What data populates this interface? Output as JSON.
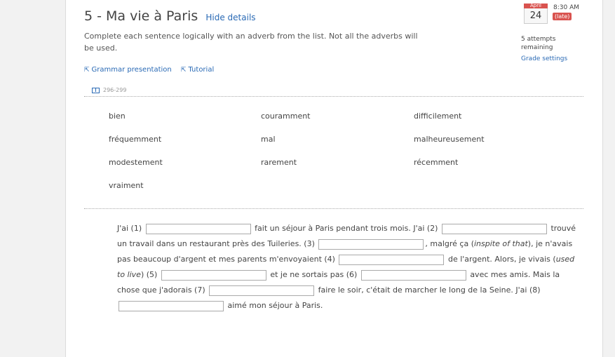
{
  "header": {
    "title": "5 - Ma vie à Paris",
    "hide_details": "Hide details"
  },
  "instructions": "Complete each sentence logically with an adverb from the list. Not all the adverbs will be used.",
  "links": {
    "grammar": "Grammar presentation",
    "tutorial": "Tutorial"
  },
  "book": {
    "pages": "296-299"
  },
  "word_bank": [
    "bien",
    "couramment",
    "difficilement",
    "fréquemment",
    "mal",
    "malheureusement",
    "modestement",
    "rarement",
    "récemment",
    "vraiment"
  ],
  "sentences": {
    "t0": "J'ai (1)",
    "t1": "fait un séjour à Paris pendant trois mois. J'ai (2)",
    "t2": "trouvé un travail dans un restaurant près des Tuileries. (3)",
    "t3": ", malgré ça (",
    "t3i": "inspite of that",
    "t4": "), je n'avais pas beaucoup d'argent et mes parents m'envoyaient (4)",
    "t5": "de l'argent. Alors, je vivais (",
    "t5i": "used to live",
    "t6": ") (5)",
    "t7": "et je ne sortais pas (6)",
    "t8": "avec mes amis. Mais la chose que j'adorais (7)",
    "t9": "faire le soir, c'était de marcher le long de la Seine. J'ai (8)",
    "t10": "aimé mon séjour à Paris."
  },
  "sidebar": {
    "month": "April",
    "day": "24",
    "time": "8:30 AM",
    "late": "(late)",
    "attempts": "5 attempts remaining",
    "grade_settings": "Grade settings"
  },
  "colors": {
    "link": "#2a6ab5",
    "late": "#d9534f"
  }
}
